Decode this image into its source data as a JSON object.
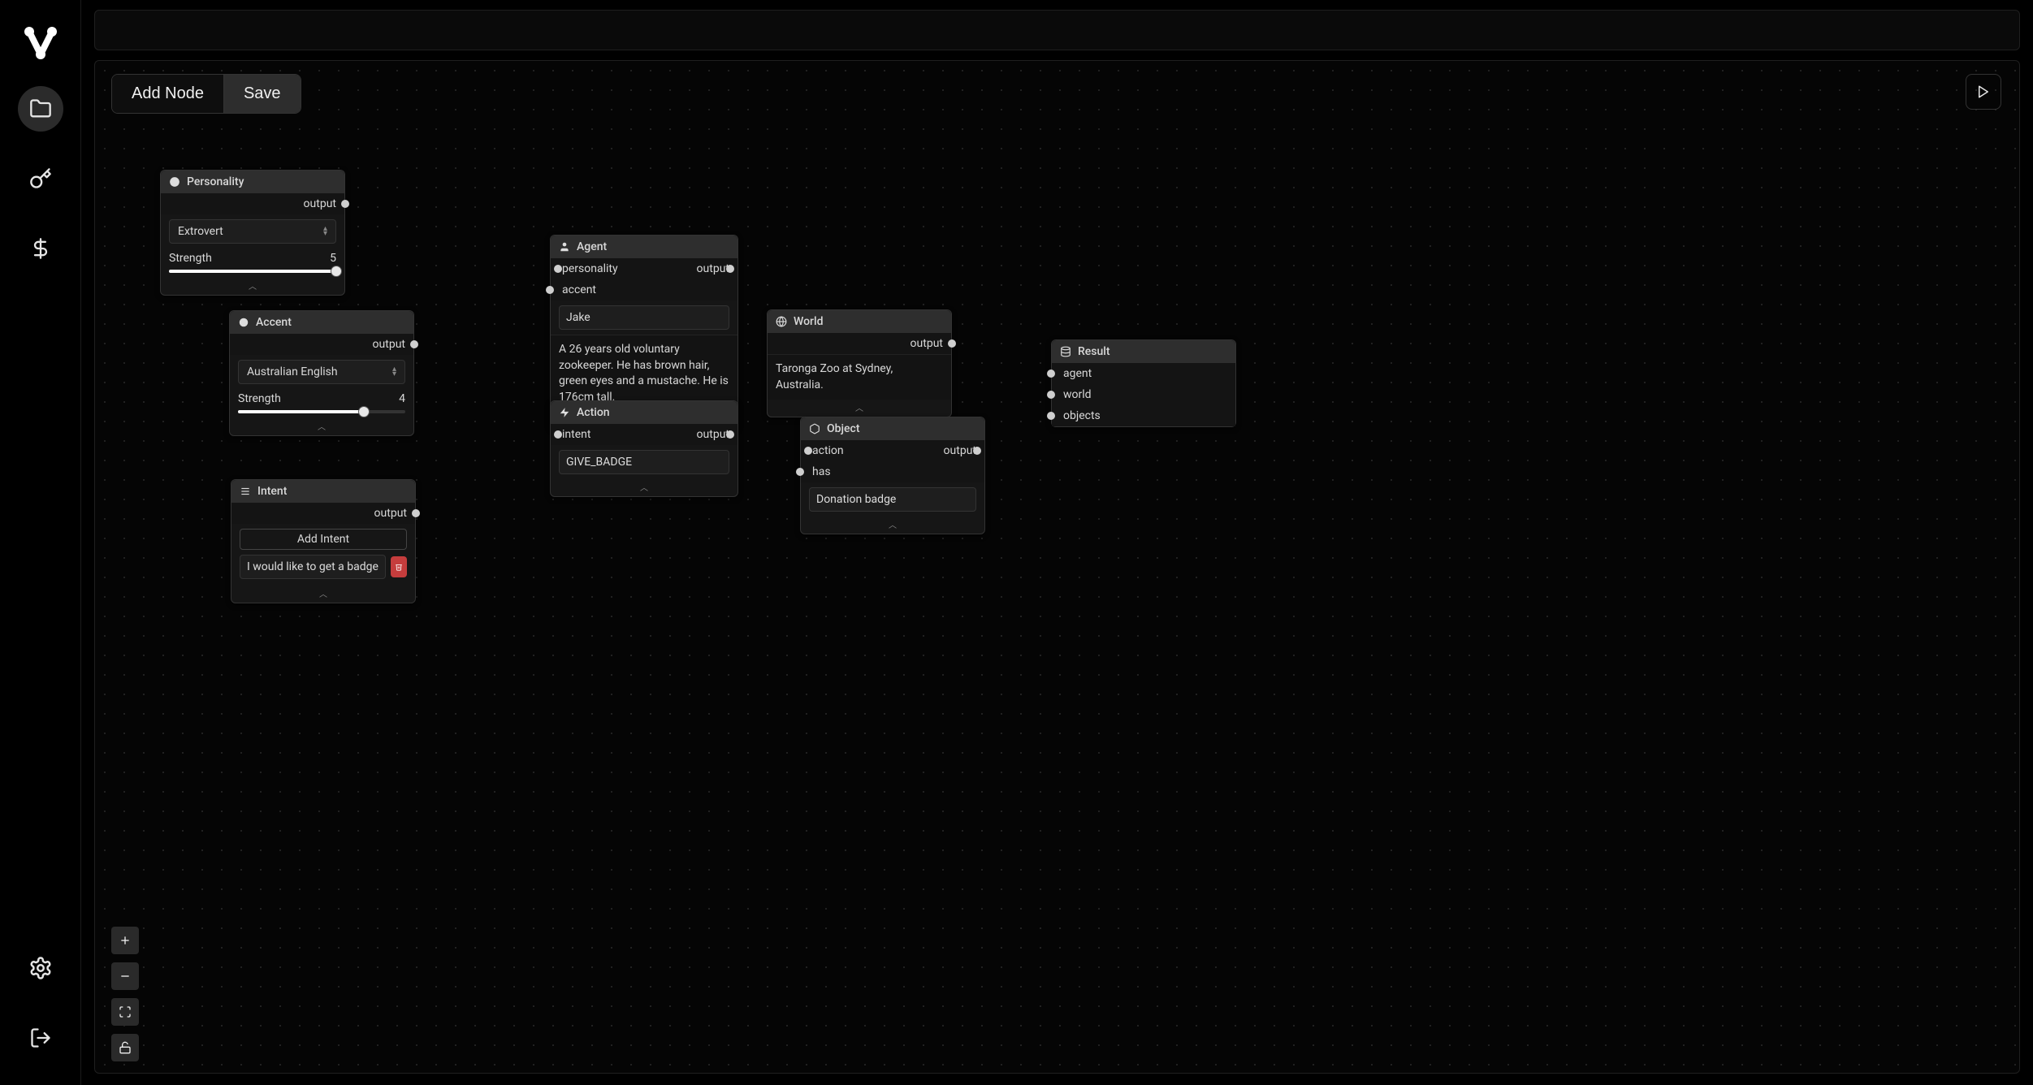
{
  "toolbar": {
    "add_node_label": "Add Node",
    "save_label": "Save"
  },
  "nodes": {
    "personality": {
      "title": "Personality",
      "output_label": "output",
      "select_value": "Extrovert",
      "strength_label": "Strength",
      "strength_value": "5",
      "strength_percent": 100
    },
    "accent": {
      "title": "Accent",
      "output_label": "output",
      "select_value": "Australian English",
      "strength_label": "Strength",
      "strength_value": "4",
      "strength_percent": 75
    },
    "agent": {
      "title": "Agent",
      "in_personality": "personality",
      "in_accent": "accent",
      "output_label": "output",
      "name_value": "Jake",
      "description": "A 26 years old voluntary zookeeper. He has brown hair, green eyes and a mustache. He is 176cm tall."
    },
    "world": {
      "title": "World",
      "output_label": "output",
      "description": "Taronga Zoo at Sydney, Australia."
    },
    "action": {
      "title": "Action",
      "in_intent": "intent",
      "output_label": "output",
      "value": "GIVE_BADGE"
    },
    "intent": {
      "title": "Intent",
      "output_label": "output",
      "add_label": "Add Intent",
      "item_value": "I would like to get a badge"
    },
    "object": {
      "title": "Object",
      "in_action": "action",
      "in_has": "has",
      "output_label": "output",
      "value": "Donation badge"
    },
    "result": {
      "title": "Result",
      "in_agent": "agent",
      "in_world": "world",
      "in_objects": "objects"
    }
  }
}
